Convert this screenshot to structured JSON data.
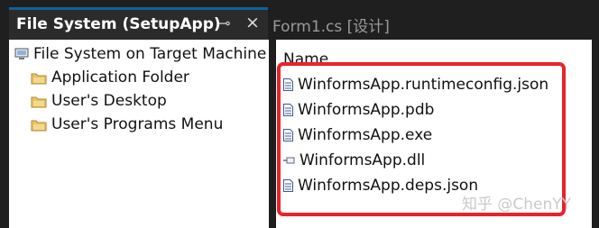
{
  "tabs": {
    "active": {
      "label": "File System (SetupApp)",
      "pin_icon": "⊸",
      "close_icon": "×"
    },
    "inactive": {
      "label": "Form1.cs [设计]"
    }
  },
  "tree": {
    "root": {
      "label": "File System on Target Machine",
      "icon": "computer-icon"
    },
    "items": [
      {
        "label": "Application Folder",
        "icon": "folder-icon"
      },
      {
        "label": "User's Desktop",
        "icon": "folder-icon"
      },
      {
        "label": "User's Programs Menu",
        "icon": "folder-icon"
      }
    ]
  },
  "file_list": {
    "column_header": "Name",
    "files": [
      {
        "name": "WinformsApp.runtimeconfig.json",
        "icon": "document-icon"
      },
      {
        "name": "WinformsApp.pdb",
        "icon": "document-icon"
      },
      {
        "name": "WinformsApp.exe",
        "icon": "document-icon"
      },
      {
        "name": "WinformsApp.dll",
        "icon": "dll-icon"
      },
      {
        "name": "WinformsApp.deps.json",
        "icon": "document-icon"
      }
    ]
  },
  "watermark": "知乎 @ChenYY",
  "colors": {
    "highlight": "#e8232a",
    "accent": "#0e639c"
  }
}
